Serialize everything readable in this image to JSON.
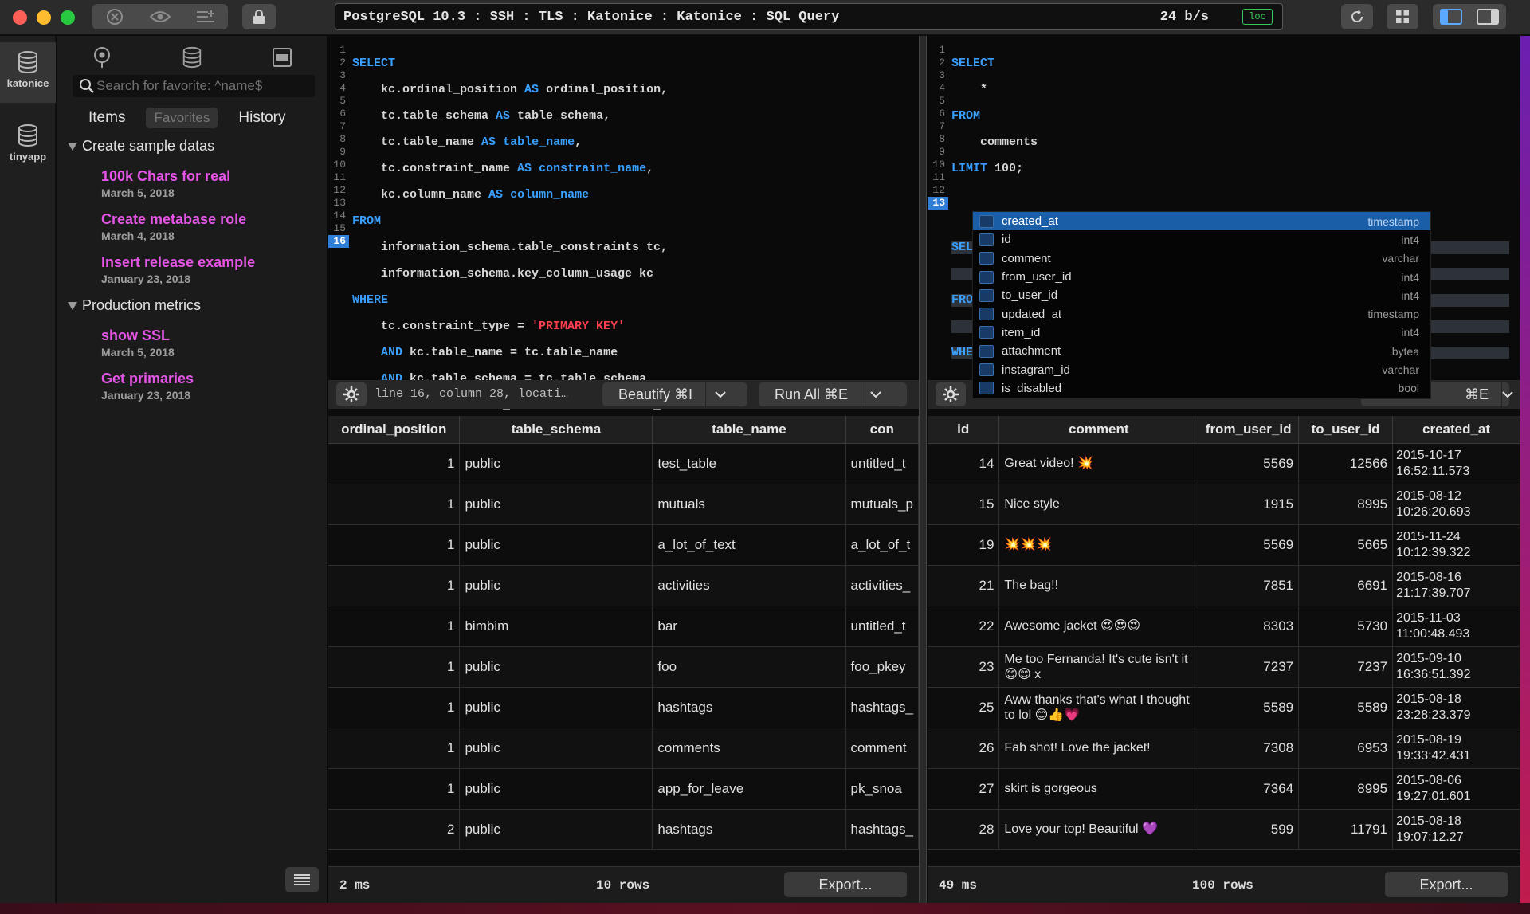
{
  "connection": {
    "title": "PostgreSQL 10.3 : SSH : TLS : Katonice : Katonice : SQL Query",
    "rate": "24 b/s",
    "badge": "loc"
  },
  "rail": [
    {
      "label": "katonice",
      "icon": "database-icon"
    },
    {
      "label": "tinyapp",
      "icon": "database-icon"
    }
  ],
  "favorites": {
    "search_placeholder": "Search for favorite: ^name$",
    "tabs": [
      "Items",
      "Favorites",
      "History"
    ],
    "groups": [
      {
        "name": "Create sample datas",
        "items": [
          {
            "name": "100k Chars for real",
            "date": "March 5, 2018"
          },
          {
            "name": "Create metabase role",
            "date": "March 4, 2018"
          },
          {
            "name": "Insert release example",
            "date": "January 23, 2018"
          }
        ]
      },
      {
        "name": "Production metrics",
        "items": [
          {
            "name": "show SSL",
            "date": "March 5, 2018"
          },
          {
            "name": "Get primaries",
            "date": "January 23, 2018"
          }
        ]
      }
    ]
  },
  "left_editor": {
    "status": "line 16, column 28, locati…",
    "beautify_label": "Beautify ⌘I",
    "run_label": "Run All ⌘E"
  },
  "right_editor": {
    "run_label": "⌘E"
  },
  "autocomplete": [
    {
      "name": "created_at",
      "type": "timestamp"
    },
    {
      "name": "id",
      "type": "int4"
    },
    {
      "name": "comment",
      "type": "varchar"
    },
    {
      "name": "from_user_id",
      "type": "int4"
    },
    {
      "name": "to_user_id",
      "type": "int4"
    },
    {
      "name": "updated_at",
      "type": "timestamp"
    },
    {
      "name": "item_id",
      "type": "int4"
    },
    {
      "name": "attachment",
      "type": "bytea"
    },
    {
      "name": "instagram_id",
      "type": "varchar"
    },
    {
      "name": "is_disabled",
      "type": "bool"
    }
  ],
  "left_results": {
    "columns": [
      "ordinal_position",
      "table_schema",
      "table_name",
      "con"
    ],
    "rows": [
      [
        "1",
        "public",
        "test_table",
        "untitled_t"
      ],
      [
        "1",
        "public",
        "mutuals",
        "mutuals_p"
      ],
      [
        "1",
        "public",
        "a_lot_of_text",
        "a_lot_of_t"
      ],
      [
        "1",
        "public",
        "activities",
        "activities_"
      ],
      [
        "1",
        "bimbim",
        "bar",
        "untitled_t"
      ],
      [
        "1",
        "public",
        "foo",
        "foo_pkey"
      ],
      [
        "1",
        "public",
        "hashtags",
        "hashtags_"
      ],
      [
        "1",
        "public",
        "comments",
        "comment"
      ],
      [
        "1",
        "public",
        "app_for_leave",
        "pk_snoa"
      ],
      [
        "2",
        "public",
        "hashtags",
        "hashtags_"
      ]
    ],
    "time": "2 ms",
    "row_count": "10 rows",
    "export_label": "Export..."
  },
  "right_results": {
    "columns": [
      "id",
      "comment",
      "from_user_id",
      "to_user_id",
      "created_at"
    ],
    "rows": [
      [
        "14",
        "Great video! 💥",
        "5569",
        "12566",
        "2015-10-17 16:52:11.573"
      ],
      [
        "15",
        "Nice style",
        "1915",
        "8995",
        "2015-08-12 10:26:20.693"
      ],
      [
        "19",
        "💥💥💥",
        "5569",
        "5665",
        "2015-11-24 10:12:39.322"
      ],
      [
        "21",
        "The bag!!",
        "7851",
        "6691",
        "2015-08-16 21:17:39.707"
      ],
      [
        "22",
        "Awesome jacket 😍😍😍",
        "8303",
        "5730",
        "2015-11-03 11:00:48.493"
      ],
      [
        "23",
        "Me too Fernanda! It's cute isn't it 😊😊 x",
        "7237",
        "7237",
        "2015-09-10 16:36:51.392"
      ],
      [
        "25",
        "Aww thanks that's what I thought to lol 😊👍💗",
        "5589",
        "5589",
        "2015-08-18 23:28:23.379"
      ],
      [
        "26",
        "Fab shot! Love the jacket!",
        "7308",
        "6953",
        "2015-08-19 19:33:42.431"
      ],
      [
        "27",
        "skirt is gorgeous",
        "7364",
        "8995",
        "2015-08-06 19:27:01.601"
      ],
      [
        "28",
        "Love your top! Beautiful 💜",
        "599",
        "11791",
        "2015-08-18 19:07:12.27"
      ]
    ],
    "time": "49 ms",
    "row_count": "100 rows",
    "export_label": "Export..."
  }
}
